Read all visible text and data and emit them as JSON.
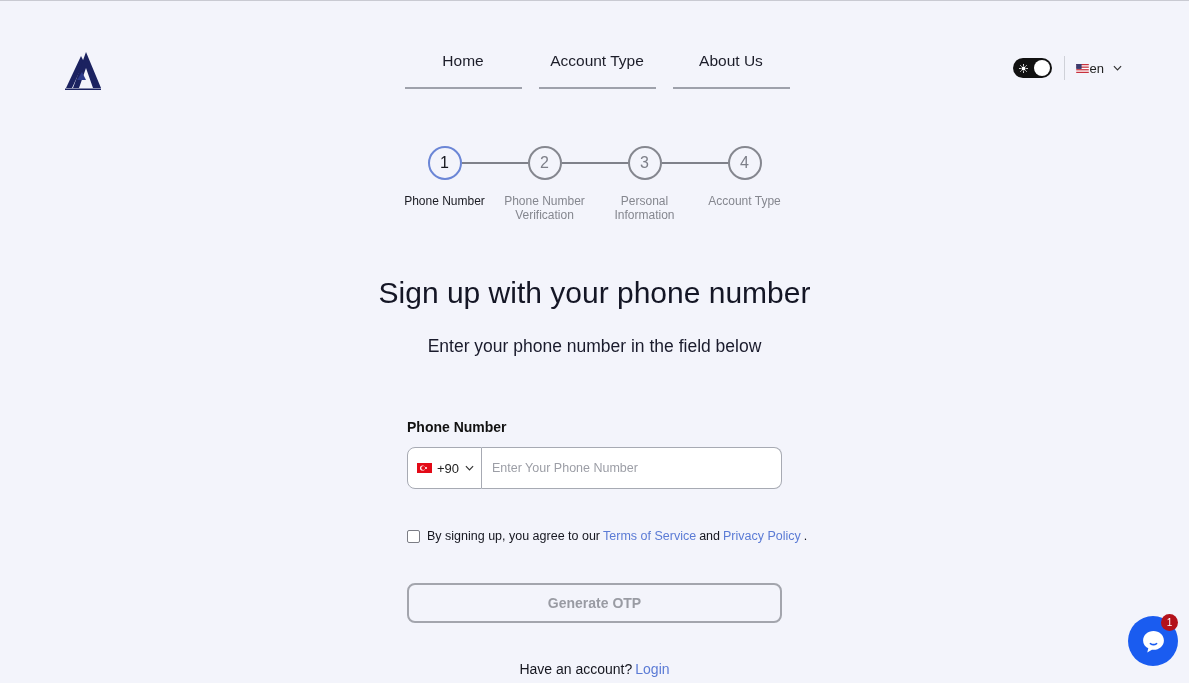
{
  "header": {
    "nav": [
      {
        "label": "Home",
        "selected": false
      },
      {
        "label": "Account Type",
        "selected": false
      },
      {
        "label": "About Us",
        "selected": false
      }
    ],
    "theme_toggle": {
      "on": true
    },
    "language": {
      "code": "en"
    }
  },
  "stepper": {
    "steps": [
      {
        "number": "1",
        "label": "Phone Number",
        "selected": true
      },
      {
        "number": "2",
        "label": "Phone Number Verification",
        "selected": false
      },
      {
        "number": "3",
        "label": "Personal Information",
        "selected": false
      },
      {
        "number": "4",
        "label": "Account Type",
        "selected": false
      }
    ]
  },
  "heading": "Sign up with your phone number",
  "subtitle": "Enter your phone number in the field below",
  "form": {
    "label": "Phone Number",
    "country_code": "+90",
    "placeholder": "Enter Your Phone Number",
    "consent": {
      "checked": false,
      "parts": [
        {
          "kind": "text",
          "text": "By signing up, you agree to our"
        },
        {
          "kind": "link",
          "text": "Terms of Service"
        },
        {
          "kind": "text",
          "text": "and"
        },
        {
          "kind": "link",
          "text": "Privacy Policy"
        },
        {
          "kind": "text",
          "text": "."
        }
      ]
    },
    "submit": {
      "label": "Generate OTP",
      "disabled": true
    }
  },
  "footer": {
    "prompt": "Have an account?",
    "link": "Login"
  },
  "chat": {
    "badge": "1"
  }
}
